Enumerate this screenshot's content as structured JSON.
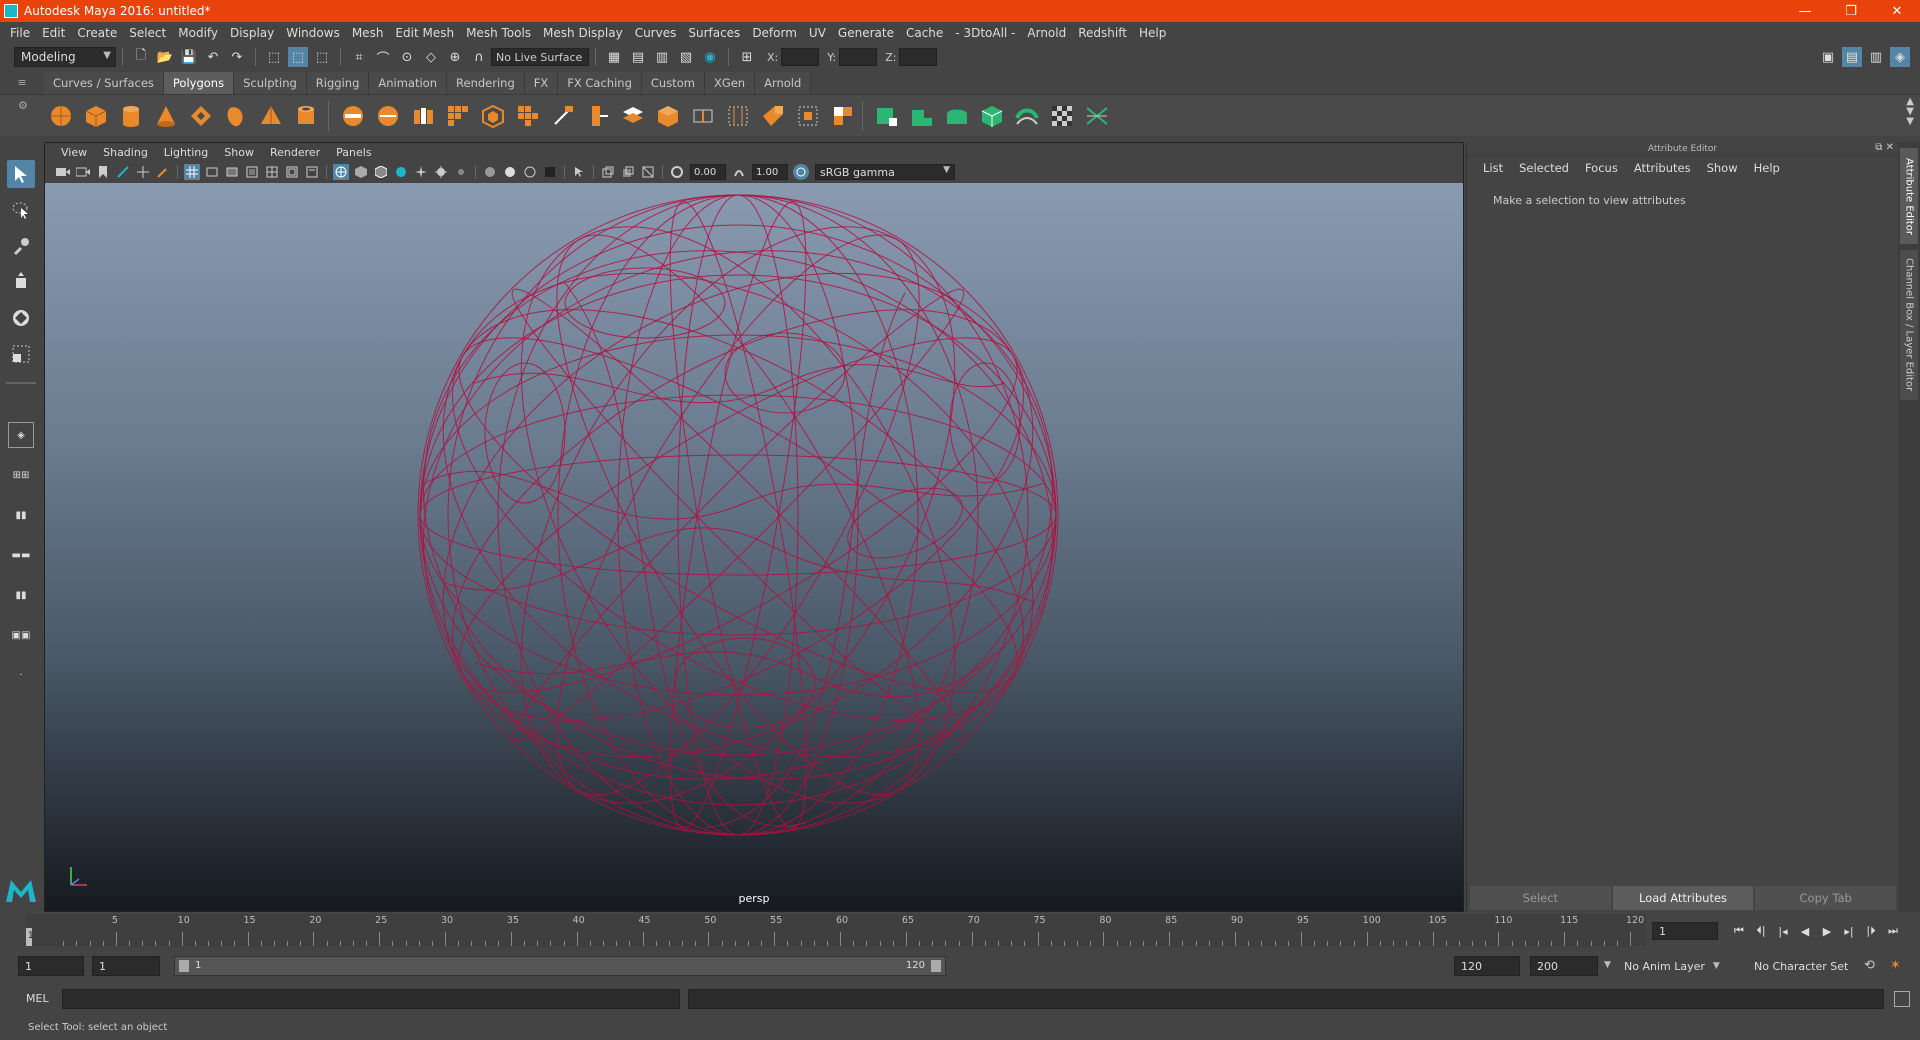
{
  "window": {
    "title": "Autodesk Maya 2016: untitled*",
    "controls": [
      "—",
      "❐",
      "✕"
    ]
  },
  "menubar": [
    "File",
    "Edit",
    "Create",
    "Select",
    "Modify",
    "Display",
    "Windows",
    "Mesh",
    "Edit Mesh",
    "Mesh Tools",
    "Mesh Display",
    "Curves",
    "Surfaces",
    "Deform",
    "UV",
    "Generate",
    "Cache",
    "- 3DtoAll -",
    "Arnold",
    "Redshift",
    "Help"
  ],
  "statusline": {
    "mode": "Modeling",
    "live_surface": "No Live Surface",
    "x_label": "X:",
    "y_label": "Y:",
    "z_label": "Z:"
  },
  "shelf_tabs": [
    "Curves / Surfaces",
    "Polygons",
    "Sculpting",
    "Rigging",
    "Animation",
    "Rendering",
    "FX",
    "FX Caching",
    "Custom",
    "XGen",
    "Arnold"
  ],
  "active_shelf_tab": "Polygons",
  "panel": {
    "menu": [
      "View",
      "Shading",
      "Lighting",
      "Show",
      "Renderer",
      "Panels"
    ],
    "exposure": "0.00",
    "gamma": "1.00",
    "color_space": "sRGB gamma",
    "camera": "persp"
  },
  "attribute_editor": {
    "title": "Attribute Editor",
    "menu": [
      "List",
      "Selected",
      "Focus",
      "Attributes",
      "Show",
      "Help"
    ],
    "message": "Make a selection to view attributes",
    "buttons": [
      "Select",
      "Load Attributes",
      "Copy Tab"
    ]
  },
  "side_tabs": [
    "Attribute Editor",
    "Channel Box / Layer Editor"
  ],
  "timeslider": {
    "ticks": [
      "5",
      "10",
      "15",
      "20",
      "25",
      "30",
      "35",
      "40",
      "45",
      "50",
      "55",
      "60",
      "65",
      "70",
      "75",
      "80",
      "85",
      "90",
      "95",
      "100",
      "105",
      "110",
      "115",
      "120"
    ],
    "current_frame_marker": "1",
    "current_frame": "1"
  },
  "rangeslider": {
    "start": "1",
    "playback_start": "1",
    "range_start_label": "1",
    "range_end_label": "120",
    "playback_end": "120",
    "end": "200",
    "anim_layer": "No Anim Layer",
    "character_set": "No Character Set"
  },
  "cmdline": {
    "label": "MEL"
  },
  "helpline": {
    "text": "Select Tool: select an object"
  },
  "colors": {
    "title_bar": "#e8430a",
    "wireframe": "#b0103e",
    "active_tool": "#5285a6",
    "shelf_icon": "#e8892c",
    "shelf_icon_green": "#2bb673"
  }
}
